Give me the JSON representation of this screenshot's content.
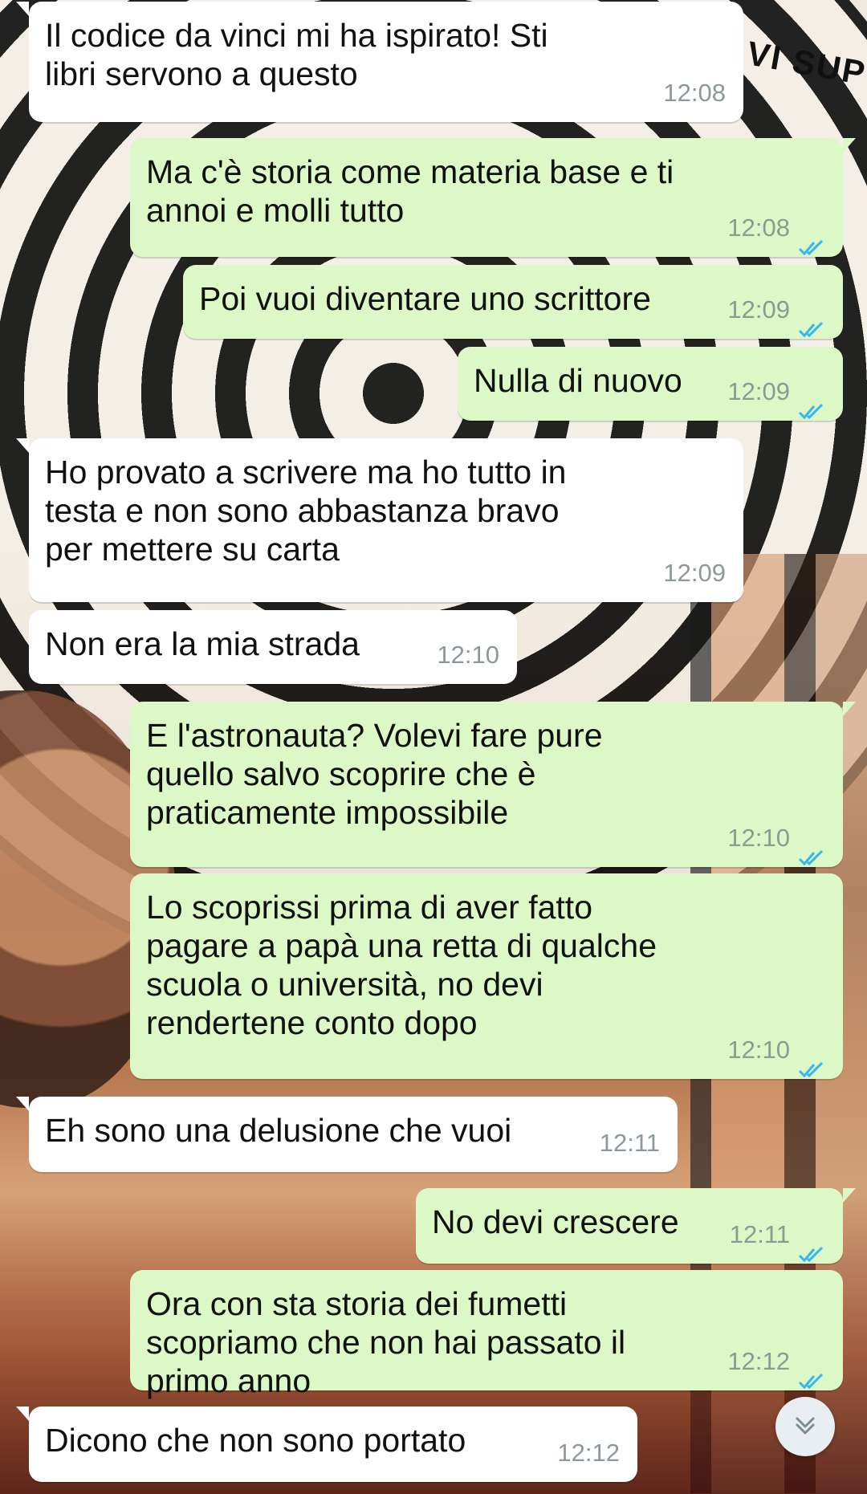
{
  "messages": [
    {
      "dir": "in",
      "text": "Il codice da vinci mi ha ispirato! Sti libri servono a questo",
      "time": "12:08"
    },
    {
      "dir": "out",
      "text": "Ma c'è storia come materia base e ti annoi e molli tutto",
      "time": "12:08",
      "ticks": "read"
    },
    {
      "dir": "out",
      "text": "Poi vuoi diventare uno scrittore",
      "time": "12:09",
      "ticks": "read"
    },
    {
      "dir": "out",
      "text": "Nulla di nuovo",
      "time": "12:09",
      "ticks": "read"
    },
    {
      "dir": "in",
      "text": "Ho provato a scrivere ma ho tutto in testa e non sono abbastanza bravo per mettere su carta",
      "time": "12:09"
    },
    {
      "dir": "in",
      "text": "Non era la mia strada",
      "time": "12:10"
    },
    {
      "dir": "out",
      "text": "E l'astronauta? Volevi fare pure quello salvo scoprire che è praticamente impossibile",
      "time": "12:10",
      "ticks": "read"
    },
    {
      "dir": "out",
      "text": "Lo scoprissi prima di aver fatto pagare a papà una retta di qualche scuola o università, no devi rendertene conto dopo",
      "time": "12:10",
      "ticks": "read"
    },
    {
      "dir": "in",
      "text": "Eh sono una delusione che vuoi",
      "time": "12:11"
    },
    {
      "dir": "out",
      "text": "No devi crescere",
      "time": "12:11",
      "ticks": "read"
    },
    {
      "dir": "out",
      "text": "Ora con sta storia dei fumetti scopriamo che non hai passato il primo anno",
      "time": "12:12",
      "ticks": "read"
    },
    {
      "dir": "in",
      "text": "Dicono che non sono portato",
      "time": "12:12"
    }
  ],
  "icons": {
    "read_receipt": "double-check-icon",
    "scroll_down": "chevron-down-icon"
  },
  "colors": {
    "incoming": "#ffffff",
    "outgoing": "#dcf8c6",
    "tick_read": "#34b7f1",
    "meta": "#8c9a92"
  },
  "wallpaper": {
    "corner_text": "VI SUP"
  }
}
